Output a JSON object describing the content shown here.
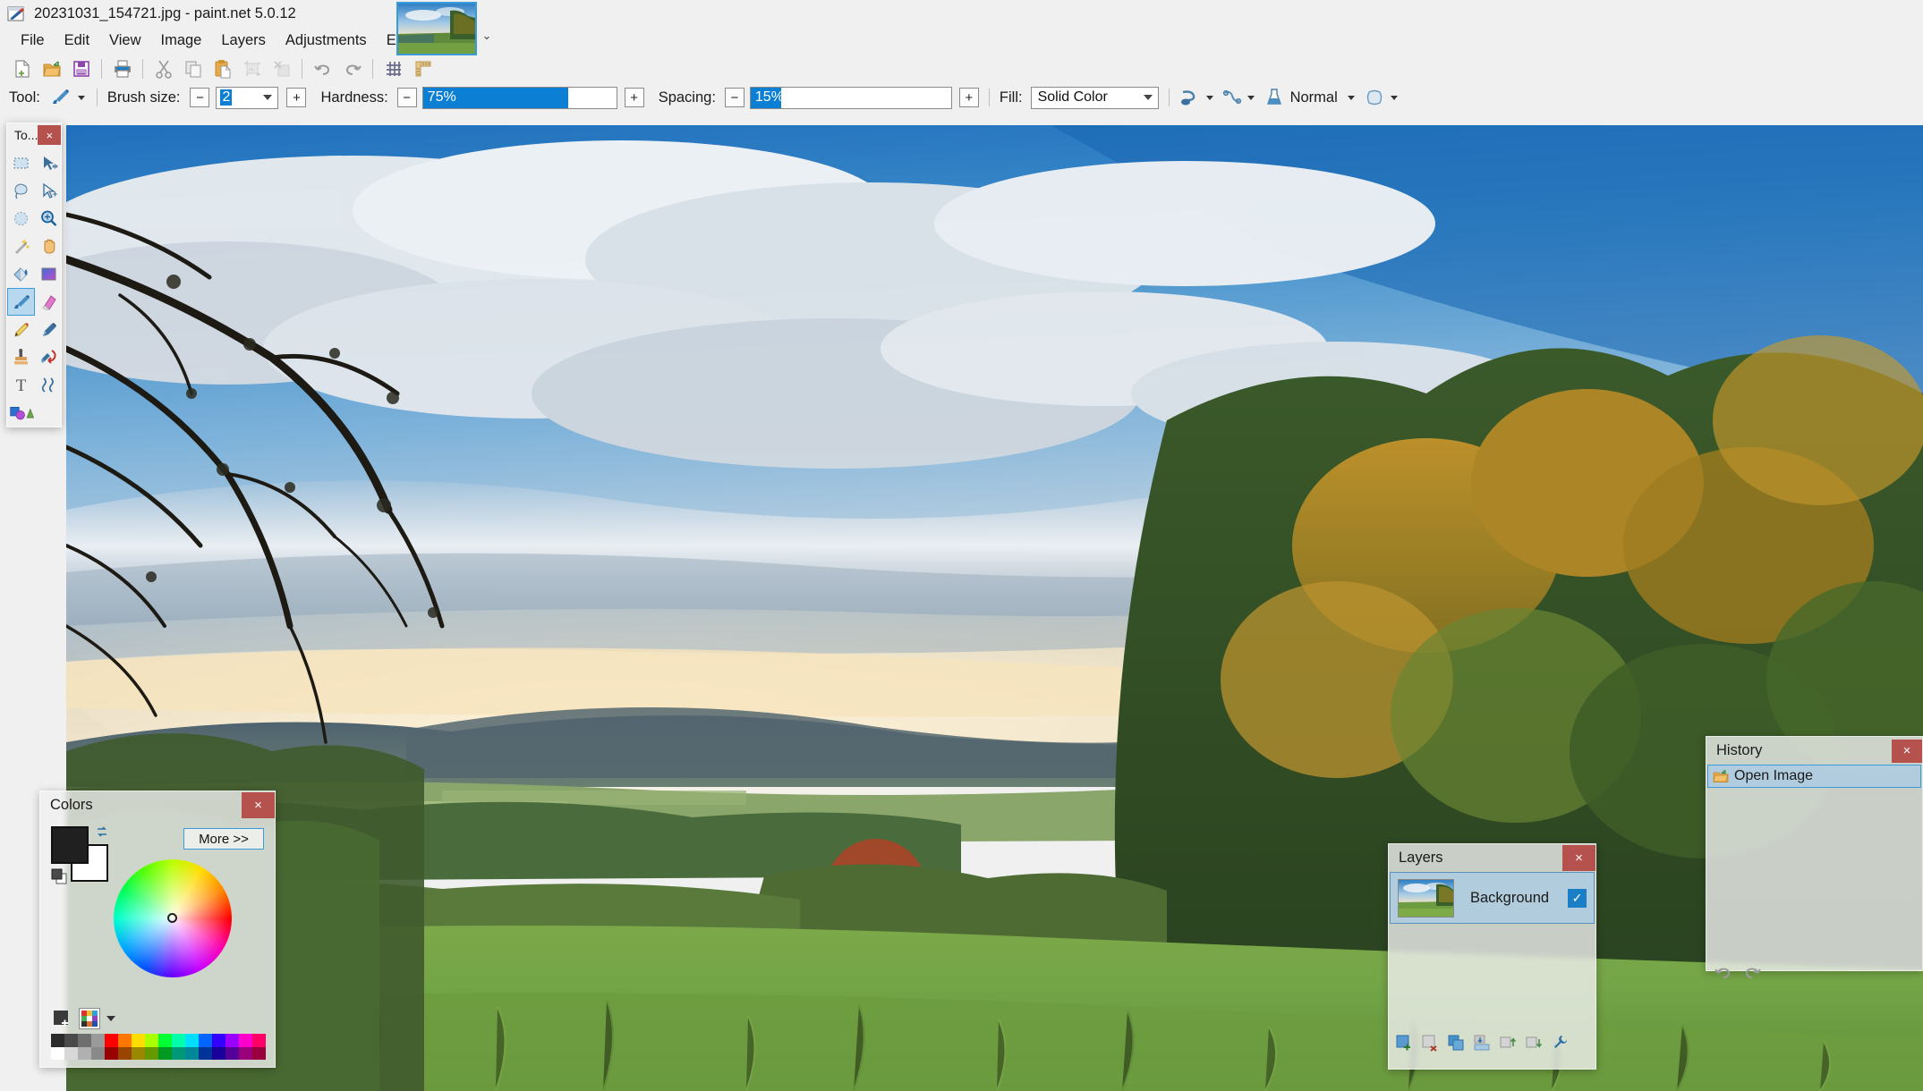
{
  "window": {
    "title": "20231031_154721.jpg - paint.net 5.0.12",
    "app_icon": "paintnet-app-icon"
  },
  "menubar": {
    "items": [
      {
        "label": "File"
      },
      {
        "label": "Edit"
      },
      {
        "label": "View"
      },
      {
        "label": "Image"
      },
      {
        "label": "Layers"
      },
      {
        "label": "Adjustments"
      },
      {
        "label": "Effects"
      }
    ]
  },
  "toolbar": {
    "buttons": [
      {
        "name": "new-icon",
        "tooltip": "New"
      },
      {
        "name": "open-icon",
        "tooltip": "Open"
      },
      {
        "name": "save-icon",
        "tooltip": "Save"
      },
      {
        "name": "print-icon",
        "tooltip": "Print"
      },
      {
        "name": "cut-icon",
        "tooltip": "Cut"
      },
      {
        "name": "copy-icon",
        "tooltip": "Copy"
      },
      {
        "name": "paste-icon",
        "tooltip": "Paste"
      },
      {
        "name": "crop-to-selection-icon",
        "tooltip": "Crop to Selection"
      },
      {
        "name": "deselect-all-icon",
        "tooltip": "Deselect All"
      },
      {
        "name": "undo-icon",
        "tooltip": "Undo"
      },
      {
        "name": "redo-icon",
        "tooltip": "Redo"
      },
      {
        "name": "grid-icon",
        "tooltip": "Grid"
      },
      {
        "name": "rulers-icon",
        "tooltip": "Rulers"
      }
    ]
  },
  "thumbstrip": {
    "open_image_label": "20231031_154721.jpg",
    "overflow_chevron": "⌄"
  },
  "options": {
    "tool_label": "Tool:",
    "tool_icon": "paintbrush-icon",
    "brush_size_label": "Brush size:",
    "brush_size_value": "2",
    "hardness_label": "Hardness:",
    "hardness_value": "75%",
    "hardness_percent": 75,
    "spacing_label": "Spacing:",
    "spacing_value": "15%",
    "spacing_percent": 15,
    "fill_label": "Fill:",
    "fill_value": "Solid Color",
    "antialiasing_icon": "antialiasing-icon",
    "smoothing_icon": "smoothing-icon",
    "blend_icon": "blend-mode-icon",
    "blend_value": "Normal",
    "clipping_icon": "selection-clipping-icon",
    "minus_glyph": "−",
    "plus_glyph": "+"
  },
  "tools_panel": {
    "title": "To...",
    "close_label": "×",
    "tools": [
      {
        "name": "rectangle-select-tool",
        "label": "Rectangle Select",
        "active": false
      },
      {
        "name": "move-selected-pixels-tool",
        "label": "Move Selected Pixels",
        "active": false
      },
      {
        "name": "lasso-select-tool",
        "label": "Lasso Select",
        "active": false
      },
      {
        "name": "move-selection-tool",
        "label": "Move Selection",
        "active": false
      },
      {
        "name": "ellipse-select-tool",
        "label": "Ellipse Select",
        "active": false
      },
      {
        "name": "zoom-tool",
        "label": "Zoom",
        "active": false
      },
      {
        "name": "magic-wand-tool",
        "label": "Magic Wand",
        "active": false
      },
      {
        "name": "pan-tool",
        "label": "Pan",
        "active": false
      },
      {
        "name": "paint-bucket-tool",
        "label": "Paint Bucket",
        "active": false
      },
      {
        "name": "gradient-tool",
        "label": "Gradient",
        "active": false
      },
      {
        "name": "paintbrush-tool",
        "label": "Paintbrush",
        "active": true
      },
      {
        "name": "eraser-tool",
        "label": "Eraser",
        "active": false
      },
      {
        "name": "pencil-tool",
        "label": "Pencil",
        "active": false
      },
      {
        "name": "color-picker-tool",
        "label": "Color Picker",
        "active": false
      },
      {
        "name": "clone-stamp-tool",
        "label": "Clone Stamp",
        "active": false
      },
      {
        "name": "recolor-tool",
        "label": "Recolor",
        "active": false
      },
      {
        "name": "text-tool",
        "label": "Text",
        "active": false
      },
      {
        "name": "line-curve-tool",
        "label": "Line / Curve",
        "active": false
      },
      {
        "name": "shapes-tool",
        "label": "Shapes",
        "active": false
      }
    ]
  },
  "colors_panel": {
    "title": "Colors",
    "close_label": "×",
    "more_label": "More >>",
    "primary_color": "#202020",
    "secondary_color": "#ffffff",
    "swap_icon": "swap-colors-icon",
    "reset_icon": "reset-colors-icon",
    "add_color_icon": "add-color-icon",
    "palette_icon": "palette-icon",
    "palette_chevron": "chevron-down-icon",
    "wheel_icon": "color-wheel",
    "swatch_row_1": [
      "#2b2b2b",
      "#4a4a4a",
      "#6e6e6e",
      "#9a9a9a",
      "#ff0000",
      "#ff7700",
      "#ffdd00",
      "#aaff00",
      "#00ff33",
      "#00ffaa",
      "#00ddff",
      "#0066ff",
      "#3300ff",
      "#9900ff",
      "#ff00cc",
      "#ff0066"
    ],
    "swatch_row_2": [
      "#ffffff",
      "#d8d8d8",
      "#b0b0b0",
      "#8a8a8a",
      "#990000",
      "#994400",
      "#998800",
      "#669900",
      "#009922",
      "#009977",
      "#008899",
      "#003399",
      "#1a0099",
      "#550099",
      "#99007a",
      "#99003d"
    ]
  },
  "layers_panel": {
    "title": "Layers",
    "close_label": "×",
    "layers": [
      {
        "name": "Background",
        "visible": true,
        "selected": true,
        "check_glyph": "✓"
      }
    ],
    "tool_buttons": [
      {
        "name": "add-new-layer-icon",
        "label": "Add New Layer"
      },
      {
        "name": "delete-layer-icon",
        "label": "Delete Layer"
      },
      {
        "name": "duplicate-layer-icon",
        "label": "Duplicate Layer"
      },
      {
        "name": "merge-layer-down-icon",
        "label": "Merge Layer Down"
      },
      {
        "name": "move-layer-up-icon",
        "label": "Move Layer Up"
      },
      {
        "name": "move-layer-down-icon",
        "label": "Move Layer Down"
      },
      {
        "name": "layer-properties-icon",
        "label": "Layer Properties"
      }
    ]
  },
  "history_panel": {
    "title": "History",
    "close_label": "×",
    "items": [
      {
        "label": "Open Image",
        "icon": "open-image-icon",
        "selected": true
      }
    ],
    "tool_buttons": [
      {
        "name": "history-undo-icon",
        "label": "Undo"
      },
      {
        "name": "history-redo-icon",
        "label": "Redo"
      }
    ]
  },
  "canvas": {
    "image_name": "20231031_154721.jpg",
    "description": "autumn-landscape-photo"
  }
}
